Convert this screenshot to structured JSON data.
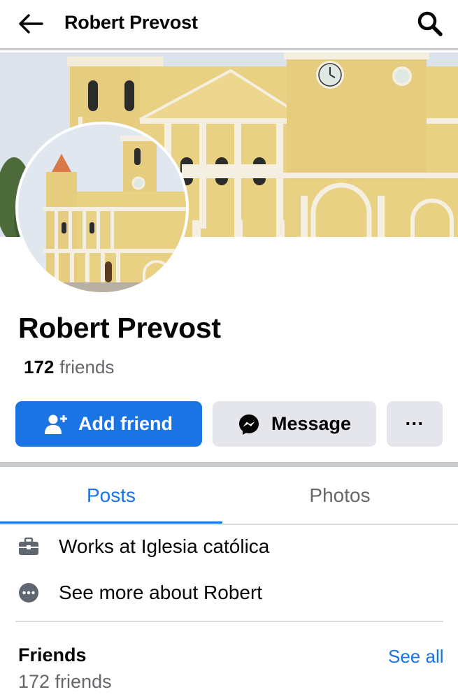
{
  "header": {
    "title": "Robert Prevost",
    "back_icon": "arrow-left-icon",
    "search_icon": "search-icon"
  },
  "profile": {
    "name": "Robert Prevost",
    "friends_count": "172",
    "friends_word": "friends"
  },
  "actions": {
    "add_friend_label": "Add friend",
    "message_label": "Message",
    "more_label": "···"
  },
  "tabs": [
    {
      "label": "Posts",
      "active": true
    },
    {
      "label": "Photos",
      "active": false
    }
  ],
  "about": {
    "work": "Works at Iglesia católica",
    "see_more": "See more about Robert"
  },
  "friends_section": {
    "heading": "Friends",
    "see_all_label": "See all",
    "count_text": "172 friends"
  },
  "colors": {
    "accent": "#1b74e4",
    "secondary_button": "#e4e6eb",
    "muted_text": "#65676b",
    "cathedral_yellow": "#e9d184"
  }
}
